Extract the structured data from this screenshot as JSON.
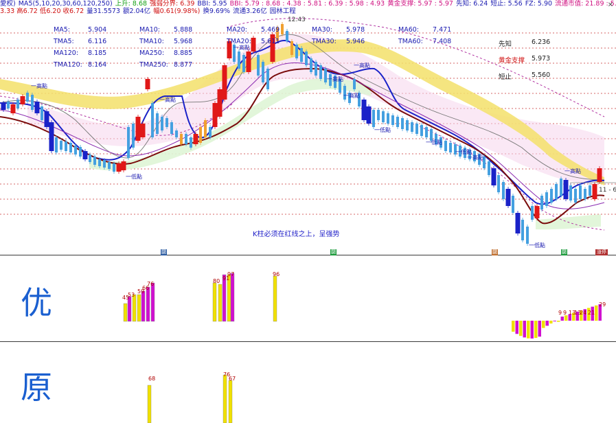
{
  "header": {
    "line1": [
      {
        "text": "愛权)",
        "color": "#1a1ab0"
      },
      {
        "text": "MA5(5,10,20,30,60,120,250)",
        "color": "#1a1ab0"
      },
      {
        "text": "上升: 8.68",
        "color": "#14a014"
      },
      {
        "text": "强弱分界: 6.39",
        "color": "#d01010"
      },
      {
        "text": "BBI: 5.95",
        "color": "#1a1ab0"
      },
      {
        "text": "BBI: 5.79 : 8.68 : 4.38 : 5.81 : 6.39 : 5.98 : 4.93",
        "color": "#d01080"
      },
      {
        "text": "黄金支撑: 5.97 : 5.97",
        "color": "#d01080"
      },
      {
        "text": "先知: 6.24",
        "color": "#1a1ab0"
      },
      {
        "text": "短止: 5.56",
        "color": "#1a1ab0"
      },
      {
        "text": "FZ: 5.90",
        "color": "#1a1ab0"
      },
      {
        "text": "流通市值: 21.89 : 5.56",
        "color": "#d01080"
      }
    ],
    "line2": [
      {
        "text": "3.33 高6.72 低6.20 收6.72",
        "color": "#d01010"
      },
      {
        "text": "量31.5573",
        "color": "#1a1ab0"
      },
      {
        "text": "额2.04亿",
        "color": "#1a1ab0"
      },
      {
        "text": "幅0.61(9.98%)",
        "color": "#d01010"
      },
      {
        "text": "换9.69%",
        "color": "#1a1ab0"
      },
      {
        "text": "流通3.26亿",
        "color": "#1a1ab0"
      },
      {
        "text": "园林工程",
        "color": "#1a1ab0"
      }
    ]
  },
  "ma_table": [
    {
      "label": "MA5:",
      "value": "5.904"
    },
    {
      "label": "MA10:",
      "value": "5.888"
    },
    {
      "label": "MA20:",
      "value": "5.469"
    },
    {
      "label": "MA30:",
      "value": "5.978"
    },
    {
      "label": "MA60:",
      "value": "7.471"
    },
    {
      "label": "TMA5:",
      "value": "6.116"
    },
    {
      "label": "TMA10:",
      "value": "5.968"
    },
    {
      "label": "TMA20:",
      "value": "5.611"
    },
    {
      "label": "TMA30:",
      "value": "5.946"
    },
    {
      "label": "TMA60:",
      "value": "7.408"
    },
    {
      "label": "MA120:",
      "value": "8.185"
    },
    {
      "label": "MA250:",
      "value": "8.885"
    },
    {
      "label": "TMA120:",
      "value": "8.164"
    },
    {
      "label": "TMA250:",
      "value": "8.877"
    }
  ],
  "side_info": [
    {
      "label": "先知",
      "value": "6.236",
      "color": "#222222"
    },
    {
      "label": "黄金支撑",
      "value": "5.973",
      "color": "#d01010"
    },
    {
      "label": "短止",
      "value": "5.560",
      "color": "#222222"
    }
  ],
  "chart_note": "K柱必须在红线之上，呈强势",
  "price_labels": {
    "top_high": "12.43",
    "right_price": "11 - 6"
  },
  "pattern_labels": [
    "高點",
    "低點",
    "高點",
    "低點",
    "高點",
    "高點",
    "低點",
    "低點",
    "高點",
    "高點",
    "高點",
    "低點",
    "高點"
  ],
  "markers": [
    {
      "text": "闘",
      "color": "#2a5aa0"
    },
    {
      "text": "闘",
      "color": "#1a9a3a"
    },
    {
      "text": "闘",
      "color": "#c07030"
    },
    {
      "text": "闘",
      "color": "#1a9a3a"
    },
    {
      "text": "涨停",
      "color": "#b03030"
    }
  ],
  "panel_labels": {
    "you": "优",
    "yuan": "原"
  },
  "indicator_you": {
    "labels": [
      "45",
      "53",
      "59",
      "66",
      "76",
      "80",
      "91",
      "97",
      "96",
      "9",
      "9",
      "13",
      "13",
      "24",
      "21",
      "29"
    ]
  },
  "indicator_yuan": {
    "labels": [
      "68",
      "76",
      "67"
    ]
  },
  "chart_data": {
    "type": "candlestick",
    "series": [
      {
        "name": "MA5",
        "last": 5.904
      },
      {
        "name": "MA10",
        "last": 5.888
      },
      {
        "name": "MA20",
        "last": 5.469
      },
      {
        "name": "MA30",
        "last": 5.978
      },
      {
        "name": "MA60",
        "last": 7.471
      },
      {
        "name": "MA120",
        "last": 8.185
      },
      {
        "name": "MA250",
        "last": 8.885
      }
    ],
    "last_bar": {
      "high": 6.72,
      "low": 6.2,
      "close": 6.72
    },
    "max_label": 12.43
  }
}
